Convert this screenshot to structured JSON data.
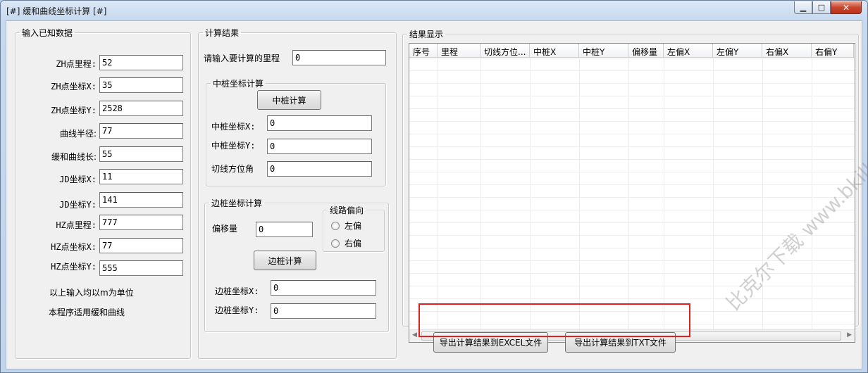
{
  "window": {
    "title": "[#] 缓和曲线坐标计算 [#]",
    "min_glyph": "▁",
    "max_glyph": "□",
    "close_glyph": "✕"
  },
  "input_group": {
    "legend": "输入已知数据",
    "fields": [
      {
        "label": "ZH点里程:",
        "value": "52"
      },
      {
        "label": "ZH点坐标X:",
        "value": "35"
      },
      {
        "label": "ZH点坐标Y:",
        "value": "2528"
      },
      {
        "label": "曲线半径:",
        "value": "77"
      },
      {
        "label": "缓和曲线长:",
        "value": "55"
      },
      {
        "label": "JD坐标X:",
        "value": "11"
      },
      {
        "label": "JD坐标Y:",
        "value": "141"
      },
      {
        "label": "HZ点里程:",
        "value": "777"
      },
      {
        "label": "HZ点坐标X:",
        "value": "77"
      },
      {
        "label": "HZ点坐标Y:",
        "value": "555"
      }
    ],
    "note1": "以上输入均以m为单位",
    "note2": "本程序适用缓和曲线"
  },
  "calc_group": {
    "legend": "计算结果",
    "mileage_label": "请输入要计算的里程",
    "mileage_value": "0",
    "center": {
      "legend": "中桩坐标计算",
      "button": "中桩计算",
      "x_label": "中桩坐标X:",
      "x_value": "0",
      "y_label": "中桩坐标Y:",
      "y_value": "0",
      "angle_label": "切线方位角",
      "angle_value": "0"
    },
    "side": {
      "legend": "边桩坐标计算",
      "offset_label": "偏移量",
      "offset_value": "0",
      "direction_legend": "线路偏向",
      "left_label": "左偏",
      "right_label": "右偏",
      "button": "边桩计算",
      "x_label": "边桩坐标X:",
      "x_value": "0",
      "y_label": "边桩坐标Y:",
      "y_value": "0"
    }
  },
  "result_group": {
    "legend": "结果显示",
    "columns": [
      "序号",
      "里程",
      "切线方位...",
      "中桩X",
      "中桩Y",
      "偏移量",
      "左偏X",
      "左偏Y",
      "右偏X",
      "右偏Y"
    ],
    "scroll_left": "◀",
    "scroll_right": "▶"
  },
  "export": {
    "excel_button": "导出计算结果到EXCEL文件",
    "txt_button": "导出计算结果到TXT文件"
  },
  "watermark": "比克尔下载 www.bkill.com"
}
